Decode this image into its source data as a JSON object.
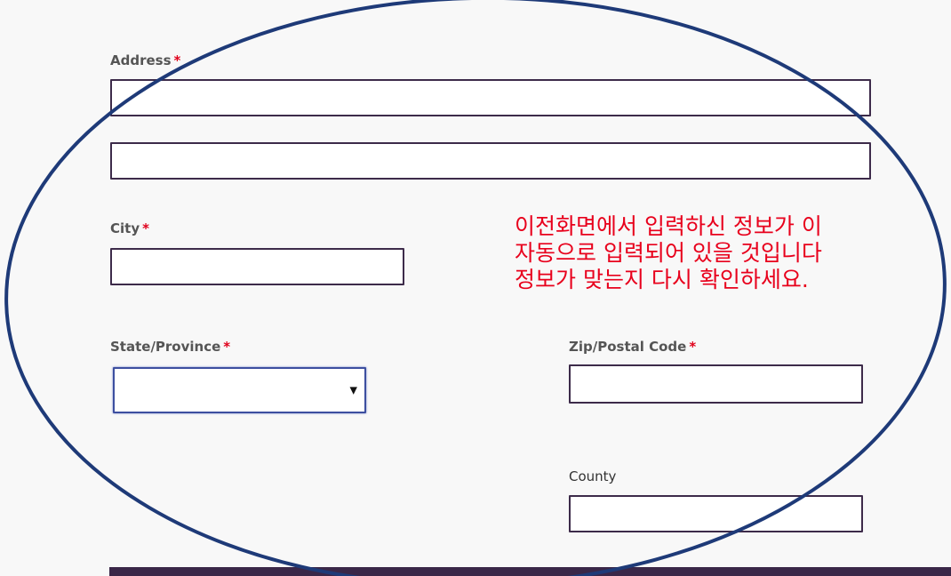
{
  "form": {
    "address": {
      "label": "Address",
      "required_mark": "*",
      "line1_value": "",
      "line2_value": ""
    },
    "city": {
      "label": "City",
      "required_mark": "*",
      "value": ""
    },
    "state": {
      "label": "State/Province",
      "required_mark": "*",
      "selected": ""
    },
    "zip": {
      "label": "Zip/Postal Code",
      "required_mark": "*",
      "value": ""
    },
    "county": {
      "label": "County",
      "value": ""
    }
  },
  "annotation": {
    "lines": [
      "이전화면에서 입력하신 정보가 이",
      "자동으로 입력되어 있을 것입니다",
      "정보가 맞는지 다시 확인하세요."
    ],
    "text_color": "#e8001c",
    "ellipse_color": "#1e3a78"
  },
  "colors": {
    "background": "#f8f8f8",
    "input_border": "#3d2b4a",
    "select_focus_border": "#3d4fa0",
    "required": "#e0001b",
    "bottom_bar": "#3a2748"
  },
  "icons": {
    "select_arrow": "caret-down-icon"
  }
}
